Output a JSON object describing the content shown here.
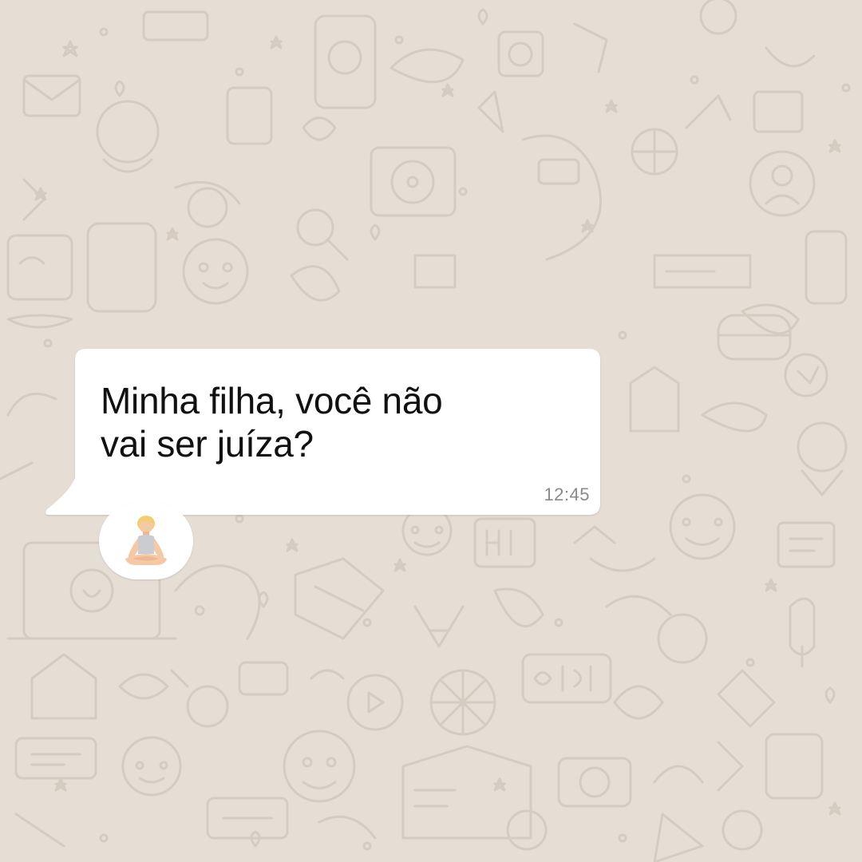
{
  "chat": {
    "message": {
      "text": "Minha filha, você não\nvai ser juíza?",
      "time": "12:45",
      "direction": "incoming"
    },
    "reaction": {
      "icon": "person-in-lotus-position-icon",
      "emoji": "🧘🏼‍♀️"
    },
    "wallpaper": {
      "style": "whatsapp-doodle-pattern"
    }
  },
  "colors": {
    "background": "#e6ddd4",
    "doodle_stroke": "#d6cbc1",
    "bubble": "#ffffff",
    "message_text": "#111111",
    "timestamp": "#8a8a8a"
  }
}
